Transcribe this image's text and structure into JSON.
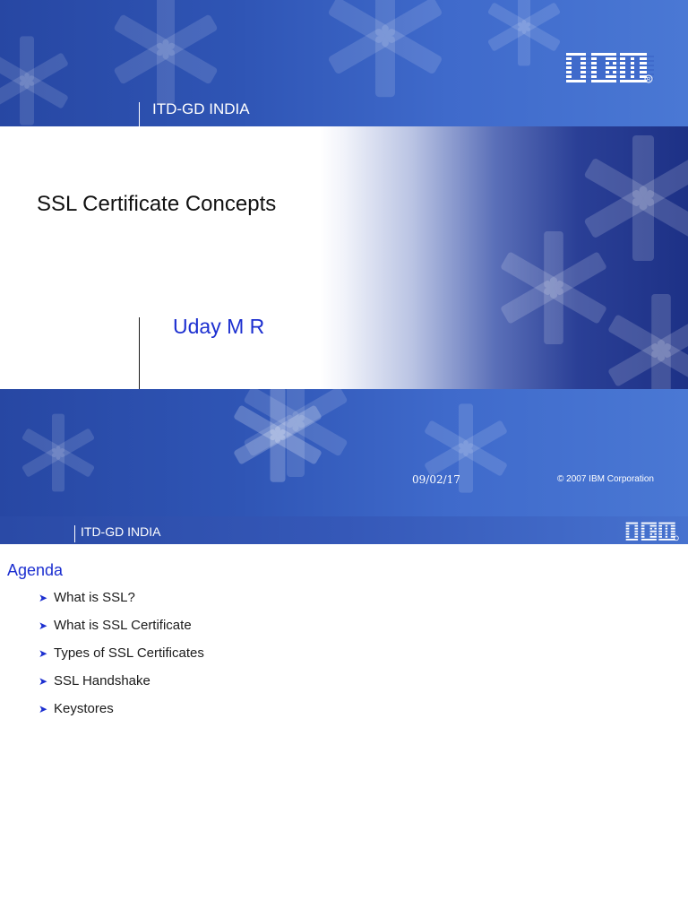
{
  "slide1": {
    "header_text": "ITD-GD INDIA",
    "logo_text": "IBM",
    "title": "SSL Certificate Concepts",
    "author": "Uday M R",
    "date": "09/02/17",
    "copyright": "© 2007 IBM Corporation"
  },
  "slide2": {
    "header_text": "ITD-GD INDIA",
    "logo_text": "IBM",
    "agenda_title": "Agenda",
    "bullet_icon": "arrow-bullet-icon",
    "items": [
      "What is SSL?",
      "What is SSL Certificate",
      "Types of SSL Certificates",
      "SSL Handshake",
      "Keystores"
    ]
  },
  "colors": {
    "accent_blue": "#1c2fd0",
    "band_blue": "#2f55b5"
  }
}
